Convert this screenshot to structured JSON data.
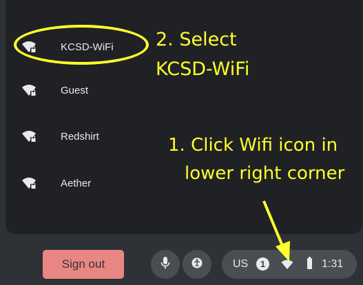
{
  "networks": [
    {
      "name": "KCSD-WiFi",
      "icon": "wifi-locked-icon"
    },
    {
      "name": "Guest",
      "icon": "wifi-locked-icon"
    },
    {
      "name": "Redshirt",
      "icon": "wifi-locked-icon"
    },
    {
      "name": "Aether",
      "icon": "wifi-locked-icon"
    }
  ],
  "shelf": {
    "sign_out_label": "Sign out",
    "mic_icon": "microphone-icon",
    "accessibility_icon": "accessibility-icon"
  },
  "tray": {
    "keyboard_layout": "US",
    "notification_count": "1",
    "wifi_icon": "wifi-icon",
    "battery_icon": "battery-icon",
    "time": "1:31"
  },
  "annotations": {
    "step2_line1": "2. Select",
    "step2_line2": "KCSD-WiFi",
    "step1_line1": "1. Click Wifi icon in",
    "step1_line2": "lower right corner"
  },
  "colors": {
    "panel": "#202124",
    "shelf": "#2e3236",
    "sign_out_button": "#e98683",
    "annotation": "#ffff2e",
    "tray": "#4a4d51"
  }
}
